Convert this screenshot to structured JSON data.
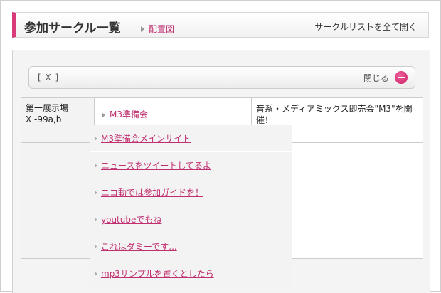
{
  "header": {
    "title": "参加サークル一覧",
    "map_link": "配置図",
    "open_all_link": "サークルリストを全て開く"
  },
  "toolbar": {
    "close_x": "[ X ]",
    "close_label": "閉じる",
    "close_icon": "minus-circle-icon"
  },
  "table": {
    "rows": [
      {
        "location_line1": "第一展示場",
        "location_line2": "X -99a,b",
        "circle_name": "M3準備会",
        "description": "音系・メディアミックス即売会\"M3\"を開催！"
      }
    ]
  },
  "dropdown": {
    "items": [
      "M3準備会メインサイト",
      "ニュースをツイートしてるよ",
      "ニコ動では参加ガイドを！",
      "youtubeでもね",
      "これはダミーです...",
      "mp3サンプルを置くとしたら"
    ]
  },
  "colors": {
    "accent": "#d83a7a",
    "link": "#c03070"
  }
}
